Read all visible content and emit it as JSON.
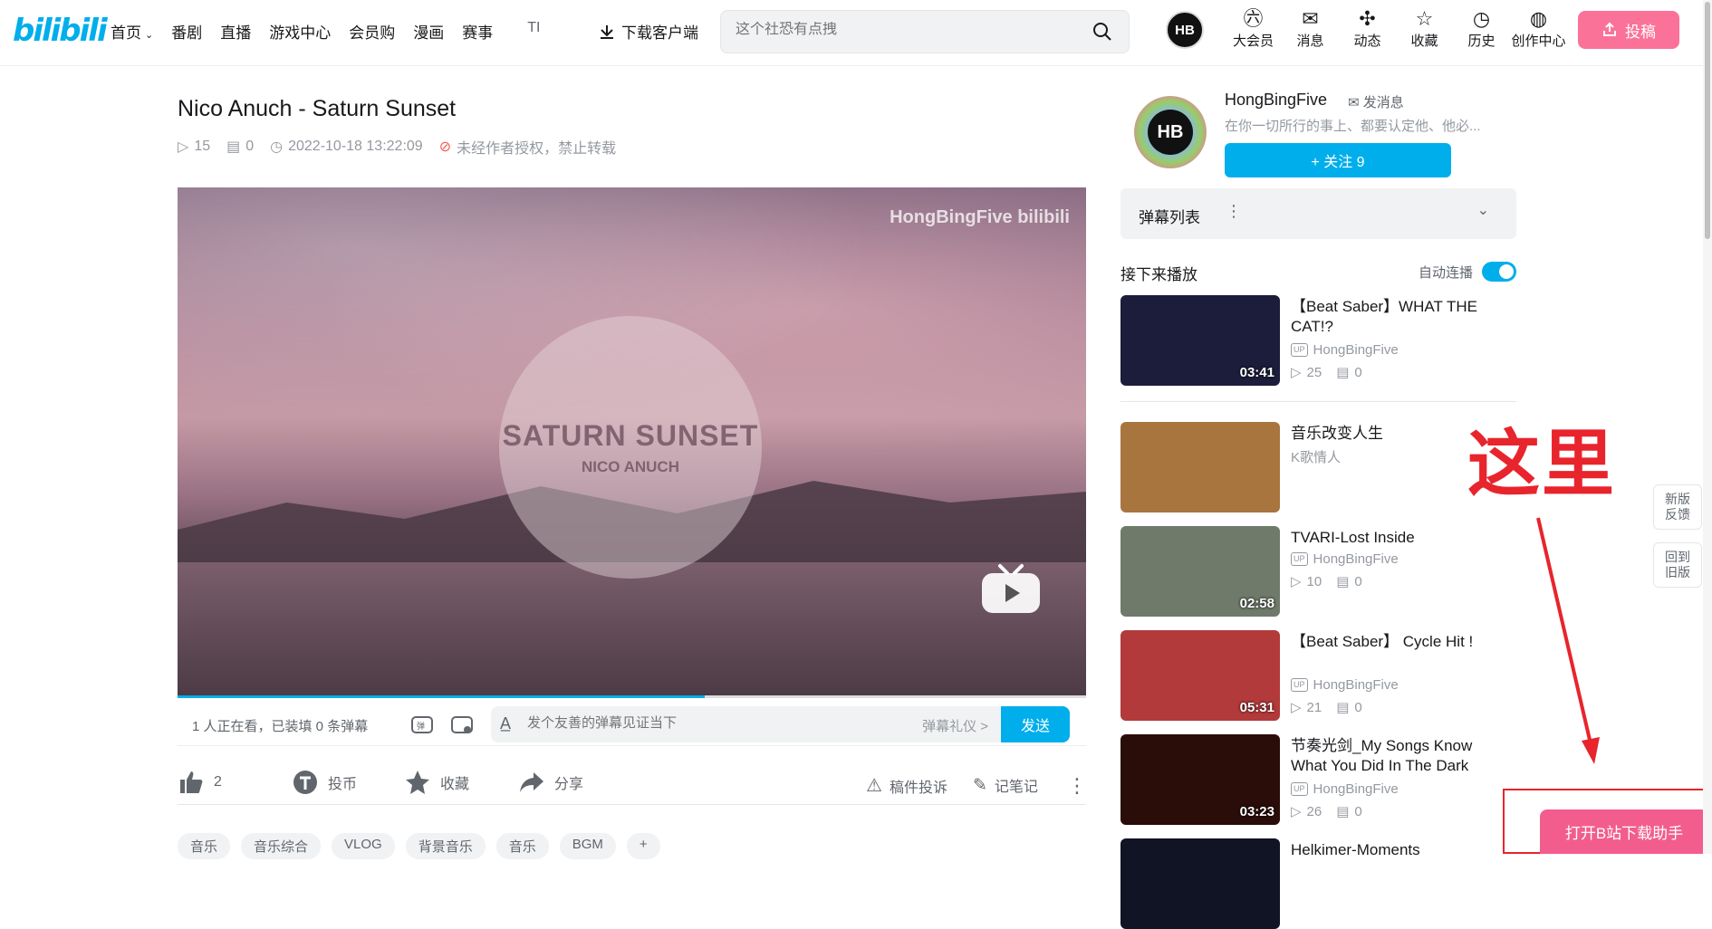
{
  "header": {
    "logo": "bilibili",
    "nav": [
      {
        "label": "首页",
        "dropdown": true
      },
      {
        "label": "番剧"
      },
      {
        "label": "直播"
      },
      {
        "label": "游戏中心"
      },
      {
        "label": "会员购"
      },
      {
        "label": "漫画"
      },
      {
        "label": "赛事"
      },
      {
        "label": "TI"
      }
    ],
    "download_label": "下载客户端",
    "search_placeholder": "这个社恐有点拽",
    "avatar_text": "HB",
    "icons": [
      {
        "label": "大会员",
        "icon": "vip-icon"
      },
      {
        "label": "消息",
        "icon": "message-icon"
      },
      {
        "label": "动态",
        "icon": "dynamic-icon"
      },
      {
        "label": "收藏",
        "icon": "favorite-icon"
      },
      {
        "label": "历史",
        "icon": "history-icon"
      },
      {
        "label": "创作中心",
        "icon": "creator-icon"
      }
    ],
    "upload_label": "投稿"
  },
  "video": {
    "title": "Nico Anuch - Saturn Sunset",
    "views": "15",
    "danmaku_count": "0",
    "date": "2022-10-18 13:22:09",
    "copyright": "未经作者授权，禁止转载",
    "watermark": "HongBingFive bilibili",
    "disc_title": "SATURN SUNSET",
    "disc_subtitle": "NICO ANUCH",
    "progress_fraction": 0.58
  },
  "danmaku_bar": {
    "watching": "1 人正在看，已装填 0 条弹幕",
    "input_placeholder": "发个友善的弹幕见证当下",
    "etiquette": "弹幕礼仪 >",
    "send": "发送"
  },
  "actions": {
    "like": "2",
    "coin": "投币",
    "favorite": "收藏",
    "share": "分享",
    "report": "稿件投诉",
    "note": "记笔记"
  },
  "tags": [
    "音乐",
    "音乐综合",
    "VLOG",
    "背景音乐",
    "音乐",
    "BGM",
    "+"
  ],
  "uploader": {
    "name": "HongBingFive",
    "message": "发消息",
    "desc": "在你一切所行的事上、都要认定他、他必...",
    "follow": "+ 关注 9",
    "avatar_text": "HB"
  },
  "danmaku_list": {
    "title": "弹幕列表"
  },
  "next_up": {
    "title": "接下来播放",
    "auto_label": "自动连播",
    "auto_on": true
  },
  "recommendations": [
    {
      "title": "【Beat Saber】WHAT THE CAT!?",
      "up": "HongBingFive",
      "views": "25",
      "dm": "0",
      "duration": "03:41",
      "thumb": "#1b1d3a"
    },
    {
      "title": "音乐改变人生",
      "up": "K歌情人",
      "views": "",
      "dm": "",
      "duration": "",
      "thumb": "#a8753f"
    },
    {
      "title": "TVARI-Lost Inside",
      "up": "HongBingFive",
      "views": "10",
      "dm": "0",
      "duration": "02:58",
      "thumb": "#6f7a6a"
    },
    {
      "title": "【Beat Saber】 Cycle Hit !",
      "up": "HongBingFive",
      "views": "21",
      "dm": "0",
      "duration": "05:31",
      "thumb": "#b33a3a"
    },
    {
      "title": "节奏光剑_My Songs Know What You Did In The Dark",
      "up": "HongBingFive",
      "views": "26",
      "dm": "0",
      "duration": "03:23",
      "thumb": "#2a0d08"
    },
    {
      "title": "Helkimer-Moments",
      "up": "",
      "views": "",
      "dm": "",
      "duration": "",
      "thumb": "#101424"
    }
  ],
  "annotation": {
    "text": "这里",
    "color": "#e8242c"
  },
  "side_buttons": [
    "新版\n反馈",
    "回到\n旧版"
  ],
  "helper_button": "打开B站下载助手",
  "colors": {
    "accent": "#00aeec",
    "pink": "#fb7299"
  }
}
